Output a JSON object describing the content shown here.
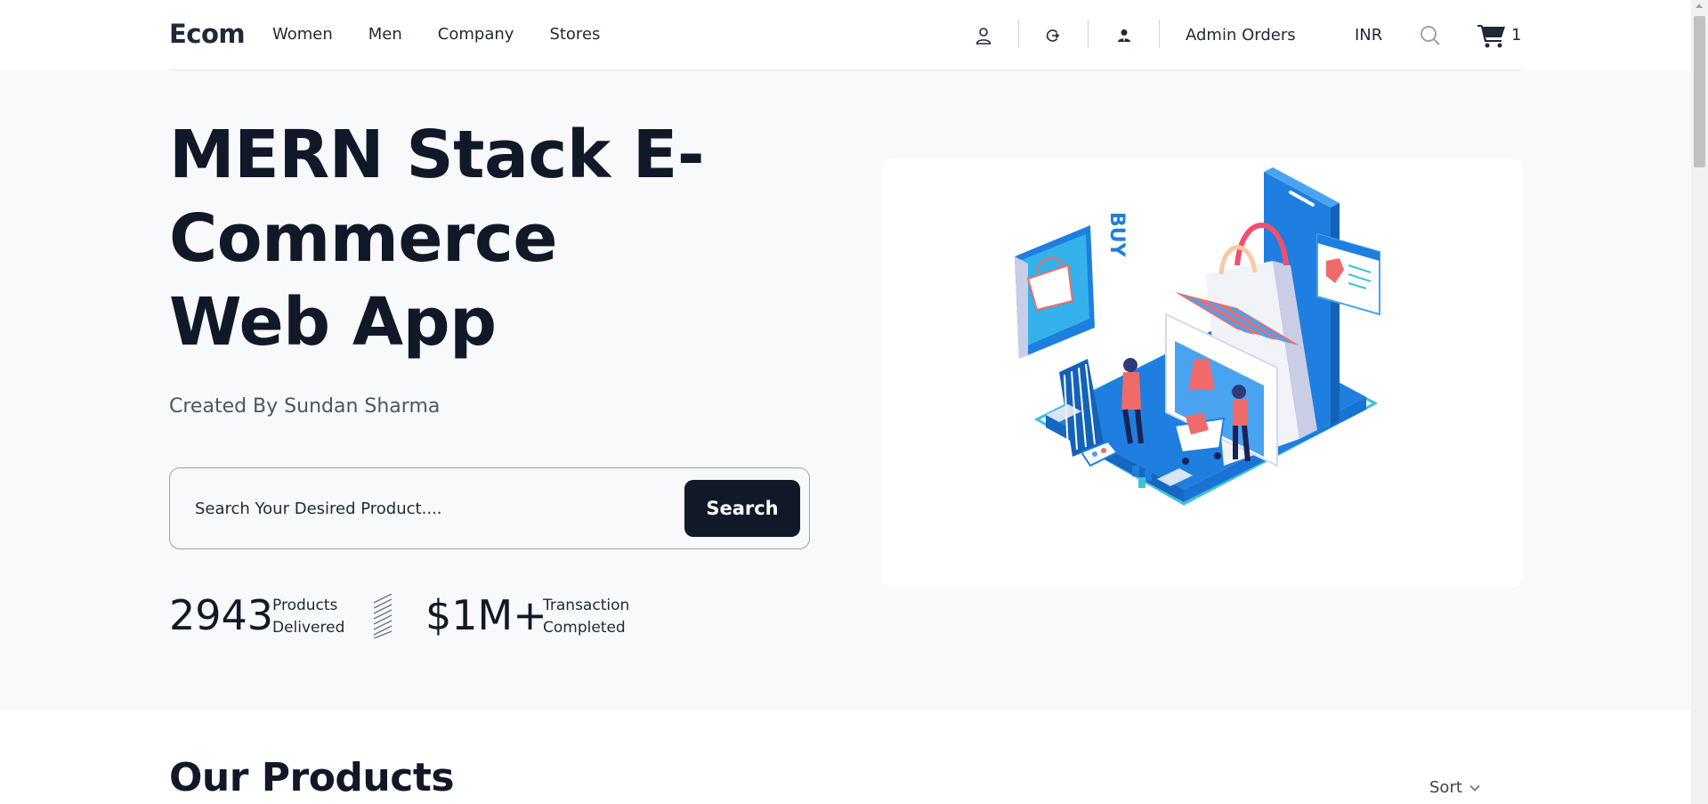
{
  "header": {
    "brand": "Ecom",
    "nav": [
      "Women",
      "Men",
      "Company",
      "Stores"
    ],
    "icons": [
      "user-icon",
      "logout-icon",
      "admin-icon"
    ],
    "admin_orders": "Admin Orders",
    "currency": "INR",
    "search_icon": "search-icon",
    "cart_icon": "cart-icon",
    "cart_count": "1"
  },
  "hero": {
    "title": "MERN Stack E-Commerce Web App",
    "subtitle": "Created By Sundan Sharma",
    "search_placeholder": "Search Your Desired Product....",
    "search_button": "Search",
    "stats": [
      {
        "value": "2943",
        "label_line1": "Products",
        "label_line2": "Delivered"
      },
      {
        "value": "$1M+",
        "label_line1": "Transaction",
        "label_line2": "Completed"
      }
    ],
    "illustration_lettering": "BUY"
  },
  "products": {
    "title": "Our Products",
    "sort_label": "Sort"
  },
  "colors": {
    "primary_dark": "#111827",
    "hero_bg": "#f8f9fb",
    "accent_blue": "#1e7fe0",
    "accent_coral": "#f06a6a"
  }
}
